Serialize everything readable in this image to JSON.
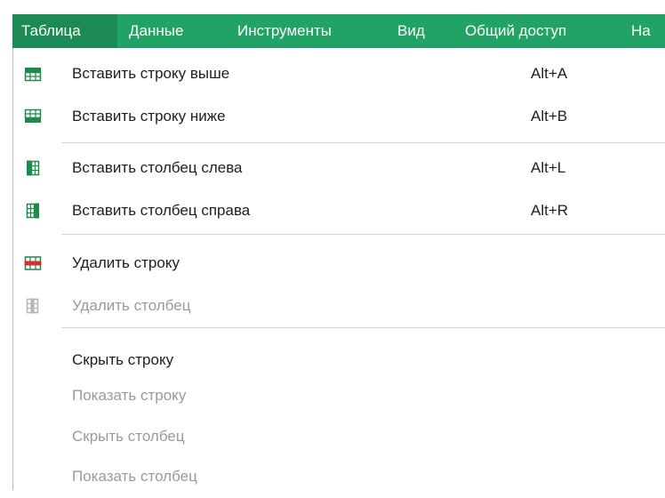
{
  "menubar": {
    "items": [
      {
        "label": "Таблица"
      },
      {
        "label": "Данные"
      },
      {
        "label": "Инструменты"
      },
      {
        "label": "Вид"
      },
      {
        "label": "Общий доступ"
      },
      {
        "label": "На"
      }
    ]
  },
  "dropdown": {
    "items": [
      {
        "label": "Вставить строку выше",
        "shortcut": "Alt+A",
        "icon": "insert-row-above-icon",
        "enabled": true
      },
      {
        "label": "Вставить строку ниже",
        "shortcut": "Alt+B",
        "icon": "insert-row-below-icon",
        "enabled": true
      },
      {
        "label": "Вставить столбец слева",
        "shortcut": "Alt+L",
        "icon": "insert-column-left-icon",
        "enabled": true
      },
      {
        "label": "Вставить столбец справа",
        "shortcut": "Alt+R",
        "icon": "insert-column-right-icon",
        "enabled": true
      },
      {
        "label": "Удалить строку",
        "icon": "delete-row-icon",
        "enabled": true
      },
      {
        "label": "Удалить столбец",
        "icon": "delete-column-icon",
        "enabled": false
      },
      {
        "label": "Скрыть строку",
        "enabled": true
      },
      {
        "label": "Показать строку",
        "enabled": false
      },
      {
        "label": "Скрыть столбец",
        "enabled": false
      },
      {
        "label": "Показать столбец",
        "enabled": false
      }
    ]
  },
  "colors": {
    "menubar_bg": "#21a366",
    "menubar_active_bg": "#1b8a55",
    "icon_green": "#1e8a4c",
    "icon_red": "#d0312d",
    "icon_disabled": "#b4b4b4"
  }
}
